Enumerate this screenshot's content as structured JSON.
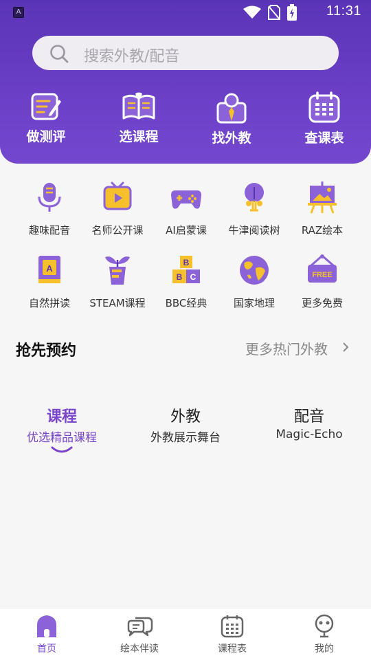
{
  "statusbar": {
    "time": "11:31",
    "app_badge": "A"
  },
  "search": {
    "placeholder": "搜索外教/配音"
  },
  "quick_actions": [
    {
      "label": "做测评",
      "icon": "test-icon"
    },
    {
      "label": "选课程",
      "icon": "open-book-icon"
    },
    {
      "label": "找外教",
      "icon": "teacher-icon"
    },
    {
      "label": "查课表",
      "icon": "calendar-icon"
    }
  ],
  "features": [
    {
      "label": "趣味配音",
      "icon": "microphone-icon"
    },
    {
      "label": "名师公开课",
      "icon": "tv-icon"
    },
    {
      "label": "AI启蒙课",
      "icon": "gamepad-icon"
    },
    {
      "label": "牛津阅读树",
      "icon": "tree-icon"
    },
    {
      "label": "RAZ绘本",
      "icon": "easel-icon"
    },
    {
      "label": "自然拼读",
      "icon": "book-a-icon"
    },
    {
      "label": "STEAM课程",
      "icon": "plant-pot-icon"
    },
    {
      "label": "BBC经典",
      "icon": "abc-blocks-icon"
    },
    {
      "label": "国家地理",
      "icon": "globe-icon"
    },
    {
      "label": "更多免费",
      "icon": "free-sign-icon"
    }
  ],
  "section": {
    "title": "抢先预约",
    "more": "更多热门外教"
  },
  "tabs": [
    {
      "title": "课程",
      "subtitle": "优选精品课程",
      "active": true
    },
    {
      "title": "外教",
      "subtitle": "外教展示舞台",
      "active": false
    },
    {
      "title": "配音",
      "subtitle": "Magic-Echo",
      "active": false
    }
  ],
  "bottom_nav": [
    {
      "label": "首页",
      "icon": "home-icon",
      "active": true
    },
    {
      "label": "绘本伴读",
      "icon": "chat-bubbles-icon",
      "active": false
    },
    {
      "label": "课程表",
      "icon": "calendar-icon",
      "active": false
    },
    {
      "label": "我的",
      "icon": "robot-face-icon",
      "active": false
    }
  ],
  "colors": {
    "primary": "#6a3fc6",
    "accent_yellow": "#f5c02b",
    "active_text": "#7a45cc"
  }
}
